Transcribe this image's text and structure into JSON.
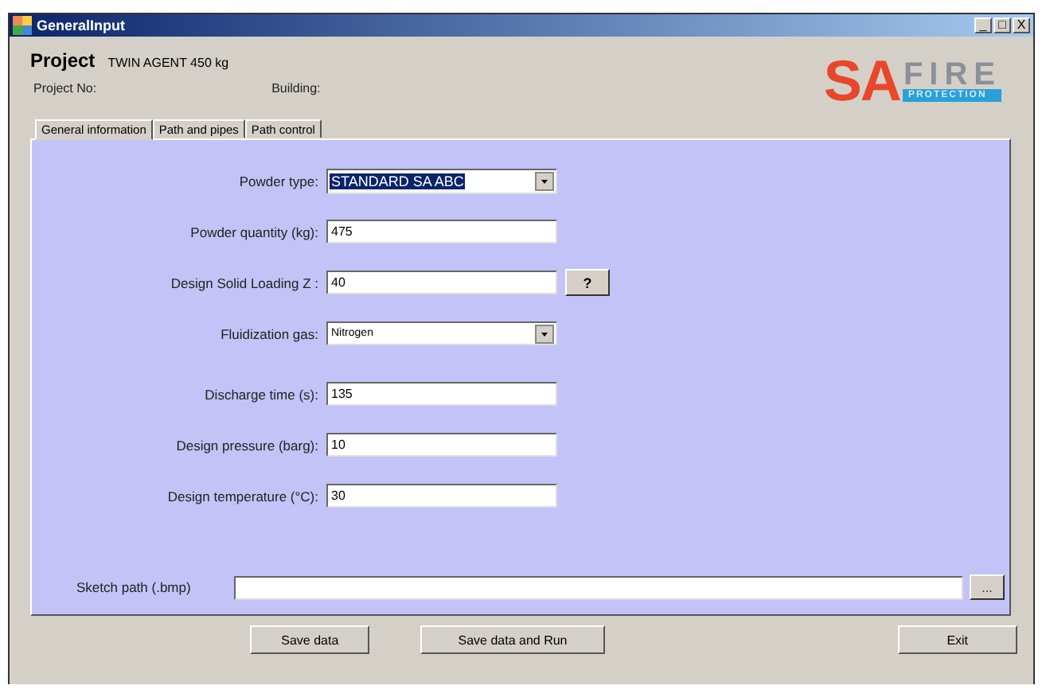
{
  "window": {
    "title": "GeneralInput",
    "controls": [
      "_",
      "□",
      "X"
    ]
  },
  "project": {
    "label": "Project",
    "name": "TWIN AGENT 450 kg",
    "number_label": "Project No:",
    "building_label": "Building:"
  },
  "logo": {
    "main": "SA",
    "accent": "FIRE",
    "tagline": "PROTECTION"
  },
  "tabs": [
    {
      "label": "General information",
      "selected": true
    },
    {
      "label": "Path and pipes",
      "selected": false
    },
    {
      "label": "Path control",
      "selected": false
    }
  ],
  "fields": [
    {
      "kind": "select",
      "label": "Powder type:",
      "value": "STANDARD SA ABC",
      "highlighted": true
    },
    {
      "kind": "text",
      "label": "Powder quantity (kg):",
      "value": "475",
      "highlighted": false
    },
    {
      "kind": "text",
      "label": "Design Solid Loading Z :",
      "value": "40",
      "highlighted": false,
      "help": "?"
    },
    {
      "kind": "select",
      "label": "Fluidization gas:",
      "value": "Nitrogen",
      "highlighted": false
    },
    {
      "kind": "text",
      "label": "Discharge time (s):",
      "value": "135",
      "highlighted": false
    },
    {
      "kind": "text",
      "label": "Design pressure (barg):",
      "value": "10",
      "highlighted": false
    },
    {
      "kind": "text",
      "label": "Design temperature (°C):",
      "value": "30",
      "highlighted": false
    }
  ],
  "sketch": {
    "label": "Sketch path (.bmp)",
    "browse": "..."
  },
  "buttons": [
    {
      "label": "Save data"
    },
    {
      "label": "Save data and Run"
    },
    {
      "label": "Exit"
    }
  ]
}
